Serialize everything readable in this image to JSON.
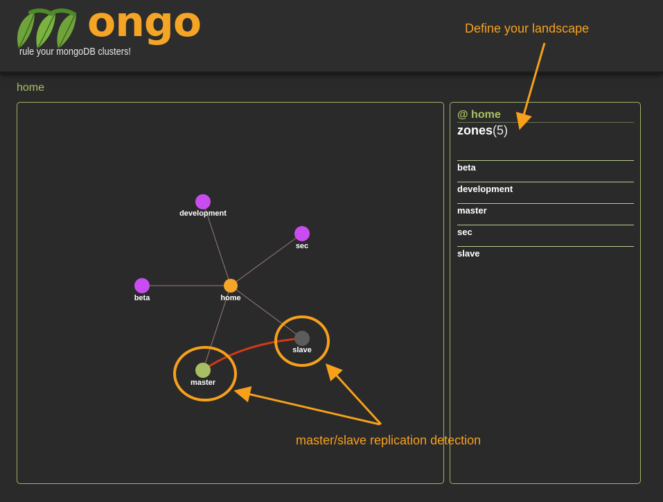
{
  "header": {
    "logo_text": "ongo",
    "tagline": "rule your mongoDB clusters!"
  },
  "annotations": {
    "landscape": "Define your landscape",
    "replication": "master/slave replication detection"
  },
  "breadcrumb": "home",
  "sidebar": {
    "at_label": "@ home",
    "title": "zones",
    "count": "(5)",
    "zones": [
      "beta",
      "development",
      "master",
      "sec",
      "slave"
    ]
  },
  "graph": {
    "nodes": {
      "development": "development",
      "sec": "sec",
      "beta": "beta",
      "home": "home",
      "slave": "slave",
      "master": "master"
    }
  },
  "colors": {
    "accent_orange": "#f7a11b",
    "zone_purple": "#c94cf0",
    "home_orange": "#f5a52a",
    "master_green": "#a7bf62",
    "slave_gray": "#5c5c5c",
    "replication_red": "#d23a16",
    "panel_border": "#9fb563"
  }
}
